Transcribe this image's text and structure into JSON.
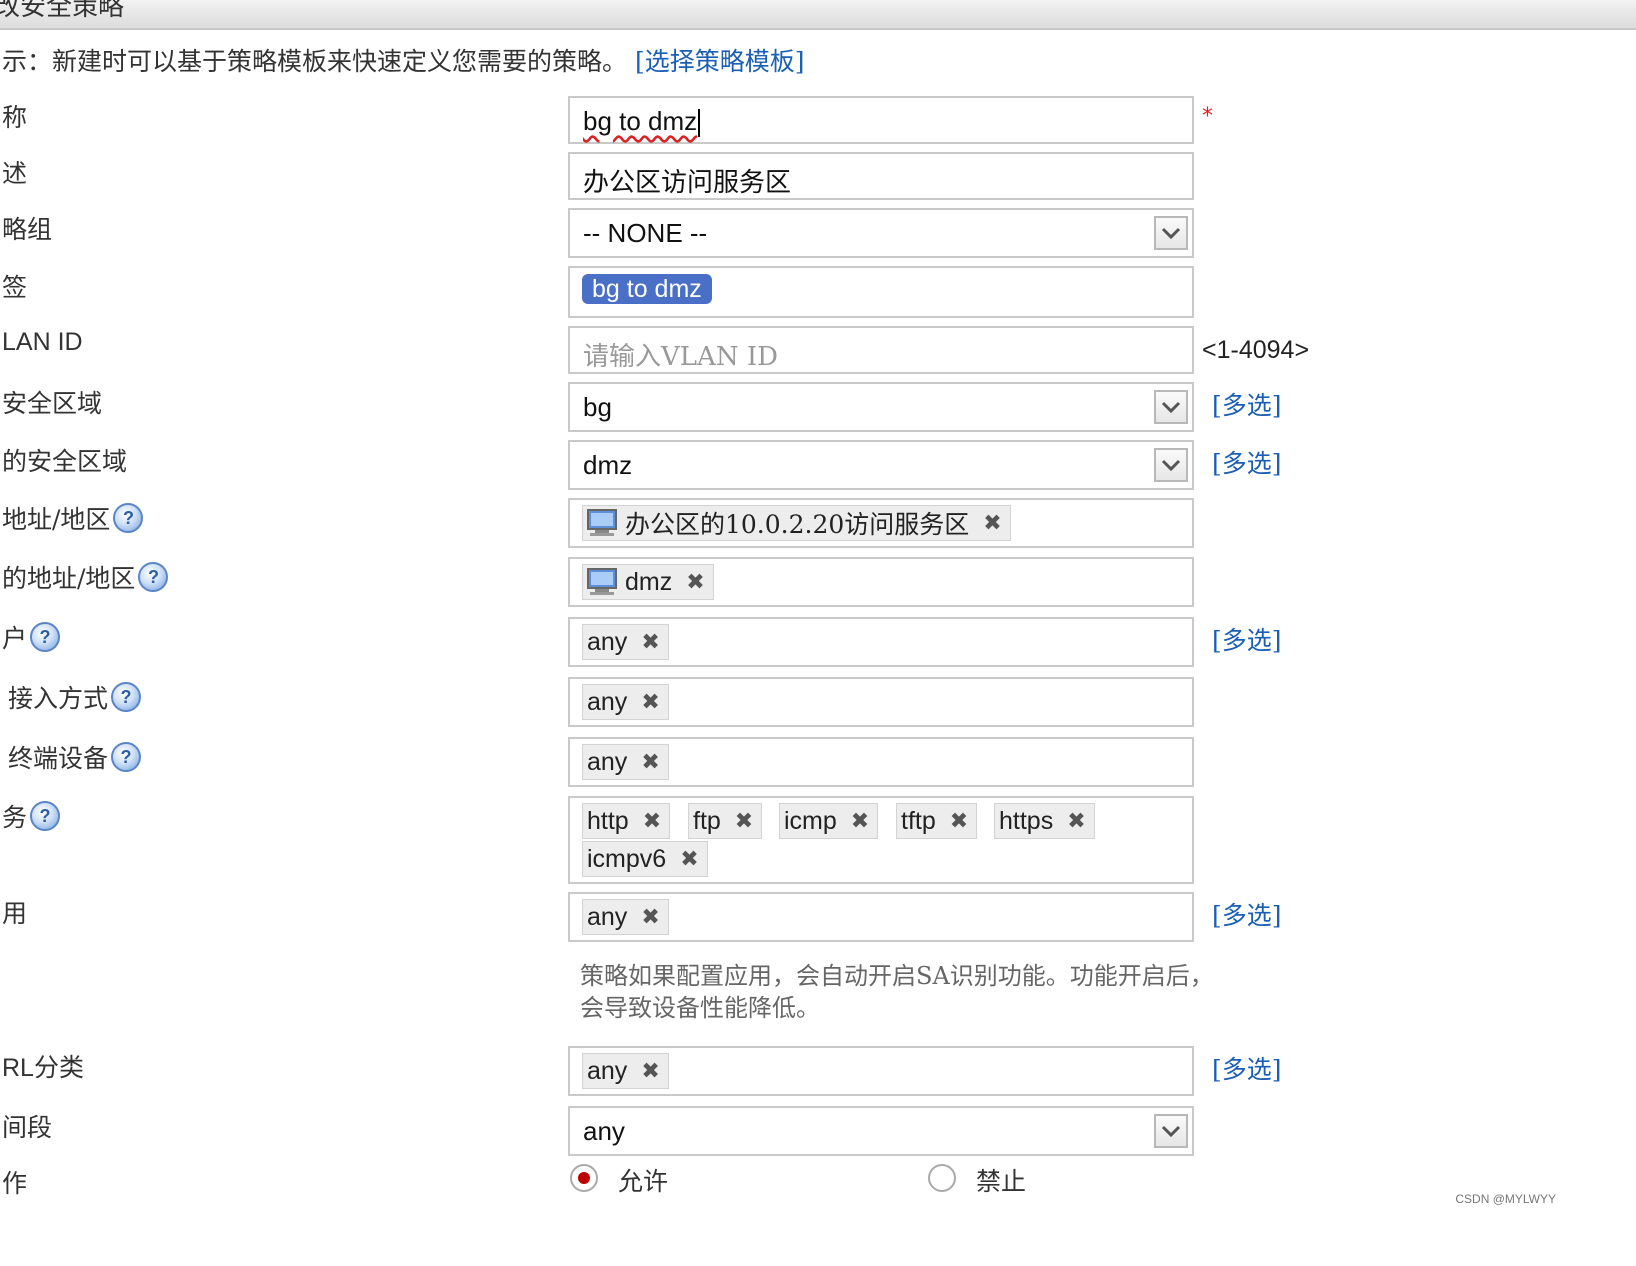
{
  "header": {
    "title": "改安全策略"
  },
  "hint": {
    "text": "示：新建时可以基于策略模板来快速定义您需要的策略。",
    "link": "[选择策略模板]"
  },
  "labels": {
    "name": "称",
    "desc": "述",
    "group": "略组",
    "tag": "签",
    "vlan": "LAN ID",
    "src_zone": "安全区域",
    "dst_zone": "的安全区域",
    "src_addr": "地址/地区",
    "dst_addr": "的地址/地区",
    "user": "户",
    "access": "接入方式",
    "terminal": "终端设备",
    "service": "务",
    "app": "用",
    "url": "RL分类",
    "time": "间段",
    "action": "作"
  },
  "fields": {
    "name": {
      "value": "bg to dmz",
      "required_mark": "*"
    },
    "desc": {
      "value": "办公区访问服务区"
    },
    "group": {
      "value": "-- NONE --"
    },
    "tag": {
      "value": "bg to dmz"
    },
    "vlan": {
      "placeholder": "请输入VLAN ID",
      "range": "<1-4094>"
    },
    "src_zone": {
      "value": "bg",
      "multi": "[多选]"
    },
    "dst_zone": {
      "value": "dmz",
      "multi": "[多选]"
    },
    "src_addr": {
      "chip": "办公区的10.0.2.20访问服务区"
    },
    "dst_addr": {
      "chip": "dmz"
    },
    "user": {
      "chip": "any",
      "multi": "[多选]"
    },
    "access": {
      "chip": "any"
    },
    "terminal": {
      "chip": "any"
    },
    "service": {
      "chips": [
        "http",
        "ftp",
        "icmp",
        "tftp",
        "https",
        "icmpv6"
      ]
    },
    "app": {
      "chip": "any",
      "multi": "[多选]",
      "note": "策略如果配置应用，会自动开启SA识别功能。功能开启后，会导致设备性能降低。"
    },
    "url": {
      "chip": "any",
      "multi": "[多选]"
    },
    "time": {
      "value": "any"
    },
    "action": {
      "allow": "允许",
      "deny": "禁止",
      "selected": "allow"
    }
  },
  "chip_remove_glyph": "✖",
  "help_glyph": "?",
  "watermark": "CSDN @MYLWYY"
}
